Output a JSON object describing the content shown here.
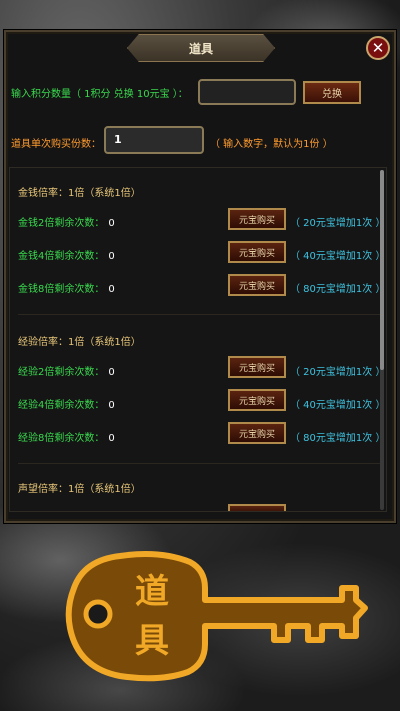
{
  "title": "道具",
  "exchange": {
    "label": "输入积分数量（ 1积分 兑换 10元宝 ）：",
    "button": "兑换",
    "value": ""
  },
  "purchase_qty": {
    "label": "道具单次购买份数：",
    "value": "1",
    "hint": "（ 输入数字，默认为1份 ）"
  },
  "sections": [
    {
      "title": "金钱倍率：1倍（系统1倍）",
      "items": [
        {
          "label": "金钱2倍剩余次数：",
          "count": "0",
          "button": "元宝购买",
          "price": "（ 20元宝增加1次 ）"
        },
        {
          "label": "金钱4倍剩余次数：",
          "count": "0",
          "button": "元宝购买",
          "price": "（ 40元宝增加1次 ）"
        },
        {
          "label": "金钱8倍剩余次数：",
          "count": "0",
          "button": "元宝购买",
          "price": "（ 80元宝增加1次 ）"
        }
      ]
    },
    {
      "title": "经验倍率：1倍（系统1倍）",
      "items": [
        {
          "label": "经验2倍剩余次数：",
          "count": "0",
          "button": "元宝购买",
          "price": "（ 20元宝增加1次 ）"
        },
        {
          "label": "经验4倍剩余次数：",
          "count": "0",
          "button": "元宝购买",
          "price": "（ 40元宝增加1次 ）"
        },
        {
          "label": "经验8倍剩余次数：",
          "count": "0",
          "button": "元宝购买",
          "price": "（ 80元宝增加1次 ）"
        }
      ]
    },
    {
      "title": "声望倍率：1倍（系统1倍）",
      "items": []
    }
  ],
  "key_badge": {
    "line1": "道",
    "line2": "具"
  },
  "icons": {
    "close": "close-icon",
    "key": "key-icon"
  },
  "colors": {
    "accent_gold": "#e8c77a",
    "green_text": "#39d94e",
    "orange_text": "#ff9b2e",
    "cyan_text": "#3ec3e0",
    "key_orange": "#e89a1a"
  }
}
